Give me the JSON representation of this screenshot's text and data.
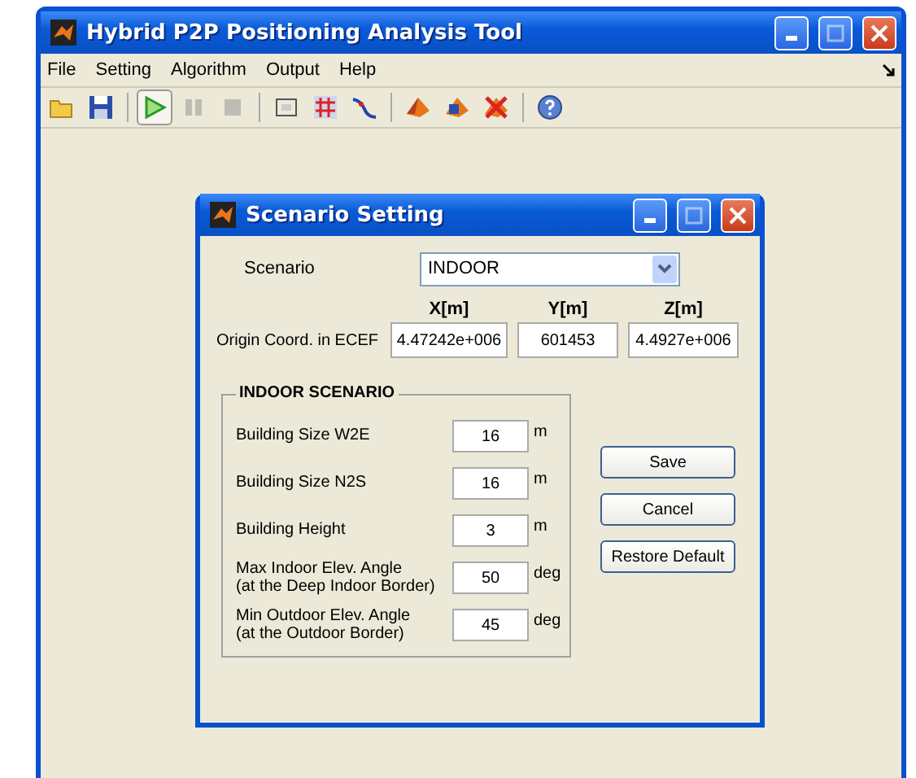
{
  "window": {
    "title": "Hybrid P2P Positioning Analysis Tool"
  },
  "menu": [
    "File",
    "Setting",
    "Algorithm",
    "Output",
    "Help"
  ],
  "toolbar": [
    [
      {
        "kind": "folder",
        "active": false,
        "disabled": false
      },
      {
        "kind": "save",
        "active": false,
        "disabled": false
      }
    ],
    [
      {
        "kind": "play",
        "active": true,
        "disabled": false
      },
      {
        "kind": "pause",
        "active": false,
        "disabled": true
      },
      {
        "kind": "stop",
        "active": false,
        "disabled": true
      }
    ],
    [
      {
        "kind": "frame",
        "active": false,
        "disabled": false
      },
      {
        "kind": "grid",
        "active": false,
        "disabled": false
      },
      {
        "kind": "curve",
        "active": false,
        "disabled": false
      }
    ],
    [
      {
        "kind": "logo",
        "active": false,
        "disabled": false
      },
      {
        "kind": "logo2",
        "active": false,
        "disabled": false
      },
      {
        "kind": "logox",
        "active": false,
        "disabled": false
      }
    ],
    [
      {
        "kind": "help",
        "active": false,
        "disabled": false
      }
    ]
  ],
  "dialog": {
    "title": "Scenario Setting",
    "scenario_label": "Scenario",
    "scenario_value": "INDOOR",
    "origin_label": "Origin Coord. in ECEF",
    "origin": [
      {
        "header": "X[m]",
        "value": "4.47242e+006"
      },
      {
        "header": "Y[m]",
        "value": "601453"
      },
      {
        "header": "Z[m]",
        "value": "4.4927e+006"
      }
    ],
    "group": {
      "title": "INDOOR SCENARIO",
      "rows": [
        {
          "label": "Building Size W2E",
          "value": "16",
          "unit": "m"
        },
        {
          "label": "Building Size N2S",
          "value": "16",
          "unit": "m"
        },
        {
          "label": "Building Height",
          "value": "3",
          "unit": "m"
        },
        {
          "label": "Max Indoor Elev. Angle\n(at the Deep Indoor Border)",
          "value": "50",
          "unit": "deg"
        },
        {
          "label": "Min Outdoor Elev. Angle\n(at the Outdoor Border)",
          "value": "45",
          "unit": "deg"
        }
      ]
    },
    "buttons": [
      "Save",
      "Cancel",
      "Restore Default"
    ]
  }
}
